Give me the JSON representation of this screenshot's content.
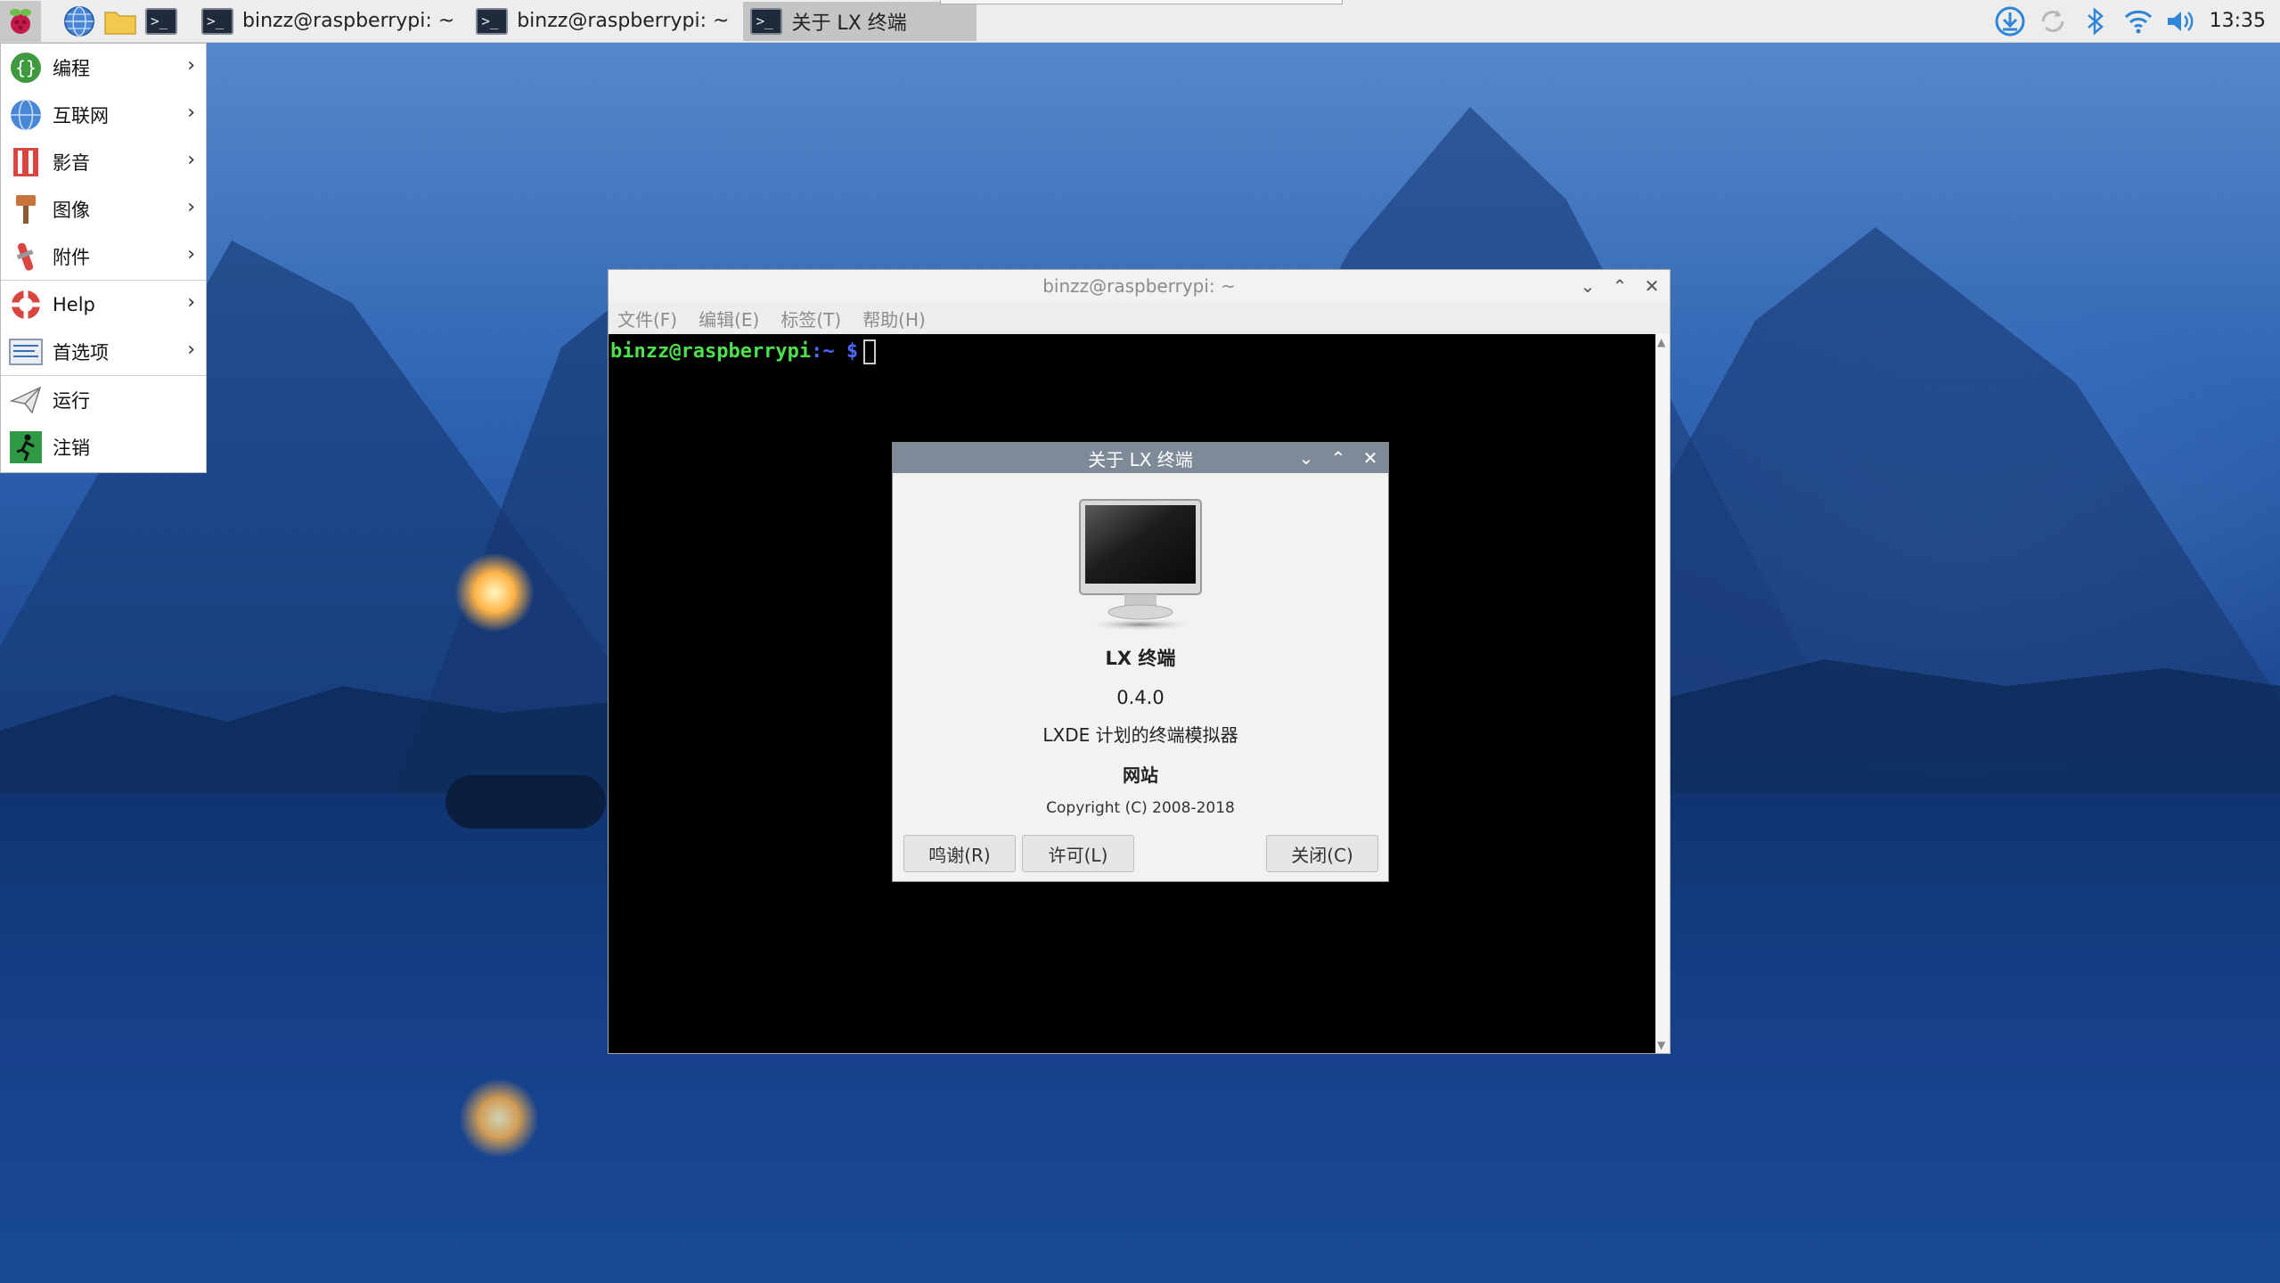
{
  "panel": {
    "tasks": [
      {
        "label": "binzz@raspberrypi: ~"
      },
      {
        "label": "binzz@raspberrypi: ~"
      },
      {
        "label": "关于 LX 终端"
      }
    ],
    "clock": "13:35"
  },
  "menu": {
    "items": [
      {
        "label": "编程",
        "icon": "programming-icon"
      },
      {
        "label": "互联网",
        "icon": "internet-globe-icon"
      },
      {
        "label": "影音",
        "icon": "sound-video-icon"
      },
      {
        "label": "图像",
        "icon": "graphics-brush-icon"
      },
      {
        "label": "附件",
        "icon": "accessories-icon"
      },
      {
        "label": "Help",
        "icon": "help-lifebuoy-icon"
      },
      {
        "label": "首选项",
        "icon": "preferences-icon"
      },
      {
        "label": "运行",
        "icon": "run-paperplane-icon"
      },
      {
        "label": "注销",
        "icon": "logout-runner-icon"
      }
    ]
  },
  "terminal": {
    "title": "binzz@raspberrypi: ~",
    "menu": [
      "文件(F)",
      "编辑(E)",
      "标签(T)",
      "帮助(H)"
    ],
    "prompt_user": "binzz@raspberrypi",
    "prompt_path": ":~ $"
  },
  "about": {
    "title": "关于 LX 终端",
    "app_name": "LX 终端",
    "version": "0.4.0",
    "description": "LXDE 计划的终端模拟器",
    "website": "网站",
    "copyright": "Copyright (C) 2008-2018",
    "buttons": {
      "credits": "鸣谢(R)",
      "license": "许可(L)",
      "close": "关闭(C)"
    }
  }
}
